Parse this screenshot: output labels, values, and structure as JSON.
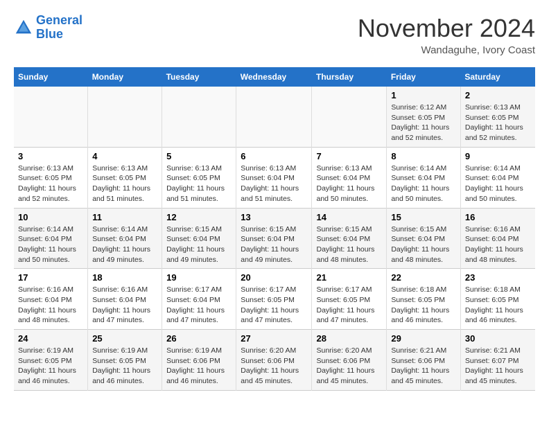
{
  "header": {
    "logo_line1": "General",
    "logo_line2": "Blue",
    "month_year": "November 2024",
    "location": "Wandaguhe, Ivory Coast"
  },
  "weekdays": [
    "Sunday",
    "Monday",
    "Tuesday",
    "Wednesday",
    "Thursday",
    "Friday",
    "Saturday"
  ],
  "weeks": [
    [
      {
        "day": "",
        "info": ""
      },
      {
        "day": "",
        "info": ""
      },
      {
        "day": "",
        "info": ""
      },
      {
        "day": "",
        "info": ""
      },
      {
        "day": "",
        "info": ""
      },
      {
        "day": "1",
        "info": "Sunrise: 6:12 AM\nSunset: 6:05 PM\nDaylight: 11 hours and 52 minutes."
      },
      {
        "day": "2",
        "info": "Sunrise: 6:13 AM\nSunset: 6:05 PM\nDaylight: 11 hours and 52 minutes."
      }
    ],
    [
      {
        "day": "3",
        "info": "Sunrise: 6:13 AM\nSunset: 6:05 PM\nDaylight: 11 hours and 52 minutes."
      },
      {
        "day": "4",
        "info": "Sunrise: 6:13 AM\nSunset: 6:05 PM\nDaylight: 11 hours and 51 minutes."
      },
      {
        "day": "5",
        "info": "Sunrise: 6:13 AM\nSunset: 6:05 PM\nDaylight: 11 hours and 51 minutes."
      },
      {
        "day": "6",
        "info": "Sunrise: 6:13 AM\nSunset: 6:04 PM\nDaylight: 11 hours and 51 minutes."
      },
      {
        "day": "7",
        "info": "Sunrise: 6:13 AM\nSunset: 6:04 PM\nDaylight: 11 hours and 50 minutes."
      },
      {
        "day": "8",
        "info": "Sunrise: 6:14 AM\nSunset: 6:04 PM\nDaylight: 11 hours and 50 minutes."
      },
      {
        "day": "9",
        "info": "Sunrise: 6:14 AM\nSunset: 6:04 PM\nDaylight: 11 hours and 50 minutes."
      }
    ],
    [
      {
        "day": "10",
        "info": "Sunrise: 6:14 AM\nSunset: 6:04 PM\nDaylight: 11 hours and 50 minutes."
      },
      {
        "day": "11",
        "info": "Sunrise: 6:14 AM\nSunset: 6:04 PM\nDaylight: 11 hours and 49 minutes."
      },
      {
        "day": "12",
        "info": "Sunrise: 6:15 AM\nSunset: 6:04 PM\nDaylight: 11 hours and 49 minutes."
      },
      {
        "day": "13",
        "info": "Sunrise: 6:15 AM\nSunset: 6:04 PM\nDaylight: 11 hours and 49 minutes."
      },
      {
        "day": "14",
        "info": "Sunrise: 6:15 AM\nSunset: 6:04 PM\nDaylight: 11 hours and 48 minutes."
      },
      {
        "day": "15",
        "info": "Sunrise: 6:15 AM\nSunset: 6:04 PM\nDaylight: 11 hours and 48 minutes."
      },
      {
        "day": "16",
        "info": "Sunrise: 6:16 AM\nSunset: 6:04 PM\nDaylight: 11 hours and 48 minutes."
      }
    ],
    [
      {
        "day": "17",
        "info": "Sunrise: 6:16 AM\nSunset: 6:04 PM\nDaylight: 11 hours and 48 minutes."
      },
      {
        "day": "18",
        "info": "Sunrise: 6:16 AM\nSunset: 6:04 PM\nDaylight: 11 hours and 47 minutes."
      },
      {
        "day": "19",
        "info": "Sunrise: 6:17 AM\nSunset: 6:04 PM\nDaylight: 11 hours and 47 minutes."
      },
      {
        "day": "20",
        "info": "Sunrise: 6:17 AM\nSunset: 6:05 PM\nDaylight: 11 hours and 47 minutes."
      },
      {
        "day": "21",
        "info": "Sunrise: 6:17 AM\nSunset: 6:05 PM\nDaylight: 11 hours and 47 minutes."
      },
      {
        "day": "22",
        "info": "Sunrise: 6:18 AM\nSunset: 6:05 PM\nDaylight: 11 hours and 46 minutes."
      },
      {
        "day": "23",
        "info": "Sunrise: 6:18 AM\nSunset: 6:05 PM\nDaylight: 11 hours and 46 minutes."
      }
    ],
    [
      {
        "day": "24",
        "info": "Sunrise: 6:19 AM\nSunset: 6:05 PM\nDaylight: 11 hours and 46 minutes."
      },
      {
        "day": "25",
        "info": "Sunrise: 6:19 AM\nSunset: 6:05 PM\nDaylight: 11 hours and 46 minutes."
      },
      {
        "day": "26",
        "info": "Sunrise: 6:19 AM\nSunset: 6:06 PM\nDaylight: 11 hours and 46 minutes."
      },
      {
        "day": "27",
        "info": "Sunrise: 6:20 AM\nSunset: 6:06 PM\nDaylight: 11 hours and 45 minutes."
      },
      {
        "day": "28",
        "info": "Sunrise: 6:20 AM\nSunset: 6:06 PM\nDaylight: 11 hours and 45 minutes."
      },
      {
        "day": "29",
        "info": "Sunrise: 6:21 AM\nSunset: 6:06 PM\nDaylight: 11 hours and 45 minutes."
      },
      {
        "day": "30",
        "info": "Sunrise: 6:21 AM\nSunset: 6:07 PM\nDaylight: 11 hours and 45 minutes."
      }
    ]
  ]
}
